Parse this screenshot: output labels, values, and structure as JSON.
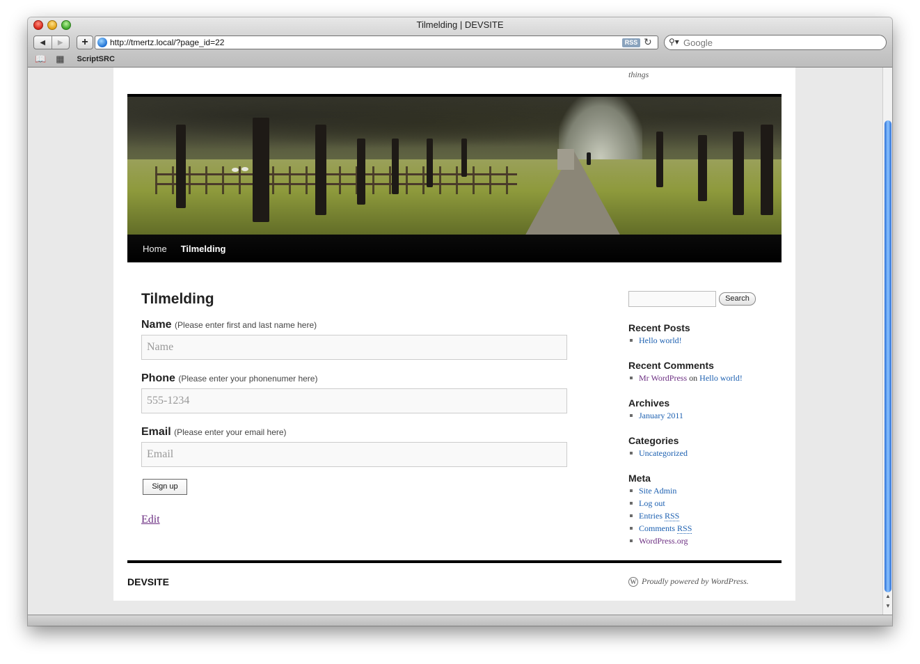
{
  "window": {
    "title": "Tilmelding | DEVSITE",
    "url": "http://tmertz.local/?page_id=22",
    "rss": "RSS",
    "search_placeholder": "Google",
    "bookmark": "ScriptSRC"
  },
  "site": {
    "tagline": "things",
    "nav": [
      {
        "label": "Home"
      },
      {
        "label": "Tilmelding"
      }
    ]
  },
  "entry": {
    "title": "Tilmelding",
    "fields": [
      {
        "label": "Name",
        "hint": "(Please enter first and last name here)",
        "placeholder": "Name"
      },
      {
        "label": "Phone",
        "hint": "(Please enter your phonenumer here)",
        "placeholder": "555-1234"
      },
      {
        "label": "Email",
        "hint": "(Please enter your email here)",
        "placeholder": "Email"
      }
    ],
    "submit": "Sign up",
    "edit": "Edit"
  },
  "sidebar": {
    "search_button": "Search",
    "recent_posts": {
      "title": "Recent Posts",
      "items": [
        "Hello world!"
      ]
    },
    "recent_comments": {
      "title": "Recent Comments",
      "author": "Mr WordPress",
      "on": "on",
      "post": "Hello world!"
    },
    "archives": {
      "title": "Archives",
      "items": [
        "January 2011"
      ]
    },
    "categories": {
      "title": "Categories",
      "items": [
        "Uncategorized"
      ]
    },
    "meta": {
      "title": "Meta",
      "site_admin": "Site Admin",
      "log_out": "Log out",
      "entries": "Entries",
      "comments": "Comments",
      "rss": "RSS",
      "wordpress_org": "WordPress.org"
    }
  },
  "footer": {
    "site_name": "DEVSITE",
    "powered": "Proudly powered by WordPress."
  },
  "colors": {
    "link": "#1b5fb0",
    "visited": "#6c2f82",
    "nav_bg": "#000000"
  }
}
